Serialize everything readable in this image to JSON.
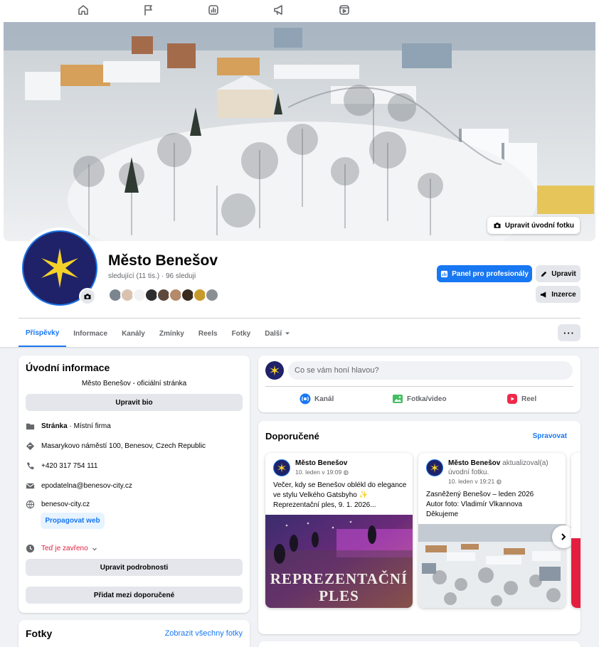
{
  "topnav": {
    "icons": [
      "home-icon",
      "flag-icon",
      "insights-icon",
      "megaphone-icon",
      "video-icon"
    ]
  },
  "cover": {
    "edit_label": "Upravit úvodní fotku"
  },
  "profile": {
    "name": "Město Benešov",
    "followers": "sledující (11 tis.) · 96 sleduji"
  },
  "actions": {
    "pro_label": "Panel pro profesionály",
    "edit_label": "Upravit",
    "ads_label": "Inzerce"
  },
  "tabs": [
    "Příspěvky",
    "Informace",
    "Kanály",
    "Zmínky",
    "Reels",
    "Fotky",
    "Další"
  ],
  "intro": {
    "title": "Úvodní informace",
    "bio": "Město Benešov - oficiální stránka",
    "edit_bio": "Upravit bio",
    "page_type_bold": "Stránka",
    "page_type_rest": " · Místní firma",
    "address": "Masarykovo náměstí 100, Benesov, Czech Republic",
    "phone": "+420 317 754 111",
    "email": "epodatelna@benesov-city.cz",
    "website": "benesov-city.cz",
    "promote": "Propagovat web",
    "hours": "Teď je zavřeno",
    "edit_details": "Upravit podrobnosti",
    "add_featured": "Přidat mezi doporučené"
  },
  "photos": {
    "title": "Fotky",
    "link": "Zobrazit všechny fotky"
  },
  "composer": {
    "placeholder": "Co se vám honí hlavou?",
    "channel": "Kanál",
    "photo_video": "Fotka/video",
    "reel": "Reel"
  },
  "recommended": {
    "title": "Doporučené",
    "manage": "Spravovat",
    "cards": [
      {
        "author": "Město Benešov",
        "date": "10. leden v 19:09",
        "lines": [
          "Večer, kdy se Benešov oblékl do elegance",
          "ve stylu Velkého Gatsbyho ✨",
          "Reprezentační ples, 9. 1. 2026..."
        ],
        "overlay_line1": "REPREZENTAČNÍ",
        "overlay_line2": "PLES"
      },
      {
        "author": "Město Benešov",
        "updated": " aktualizoval(a) úvodní fotku.",
        "date": "10. leden v 19:21",
        "lines": [
          "Zasněžený Benešov – leden 2026",
          "Autor foto: Vladimír Vlkannova",
          "Děkujeme"
        ]
      }
    ]
  },
  "colors": {
    "brand_blue": "#1877f2",
    "logo_navy": "#1f2268",
    "logo_star": "#f4d12a",
    "closed_red": "#e41e3f"
  }
}
